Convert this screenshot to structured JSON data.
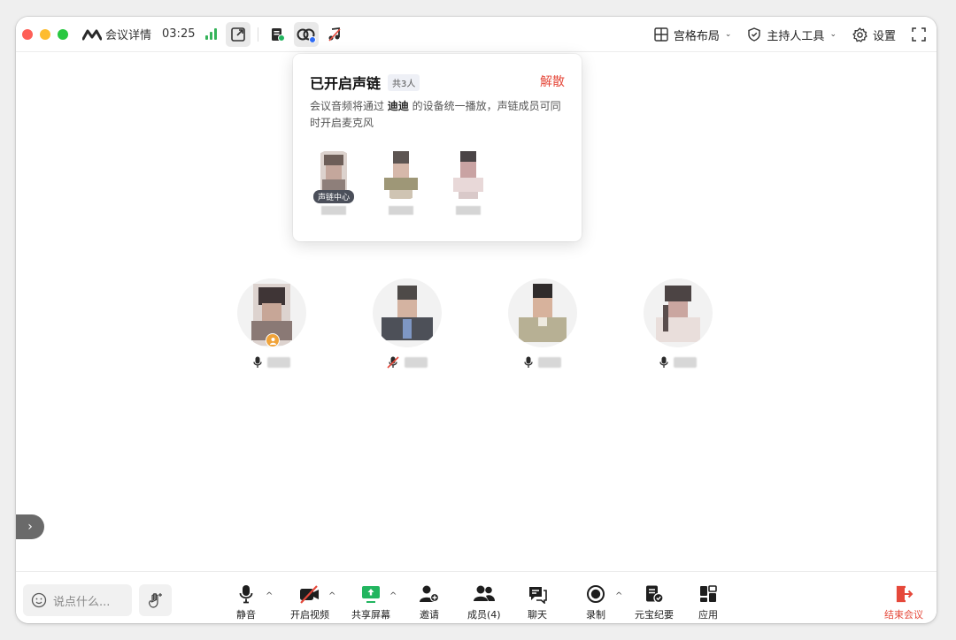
{
  "titlebar": {
    "meeting_detail": "会议详情",
    "timer": "03:25"
  },
  "right_tools": {
    "layout": "宫格布局",
    "host_tools": "主持人工具",
    "settings": "设置"
  },
  "popover": {
    "title": "已开启声链",
    "count": "共3人",
    "dismiss": "解散",
    "desc_prefix": "会议音频将通过 ",
    "desc_device": "迪迪",
    "desc_suffix": " 的设备统一播放，声链成员可同时开启麦克风",
    "center_badge": "声链中心"
  },
  "chat": {
    "placeholder": "说点什么..."
  },
  "toolbar": {
    "mute": "静音",
    "video": "开启视频",
    "share": "共享屏幕",
    "invite": "邀请",
    "members": "成员(4)",
    "chat": "聊天",
    "record": "录制",
    "yuanbao": "元宝纪要",
    "apps": "应用",
    "end": "结束会议"
  },
  "colors": {
    "accent_green": "#22b55f",
    "danger_red": "#e5483a",
    "host_badge": "#f0a33a"
  }
}
